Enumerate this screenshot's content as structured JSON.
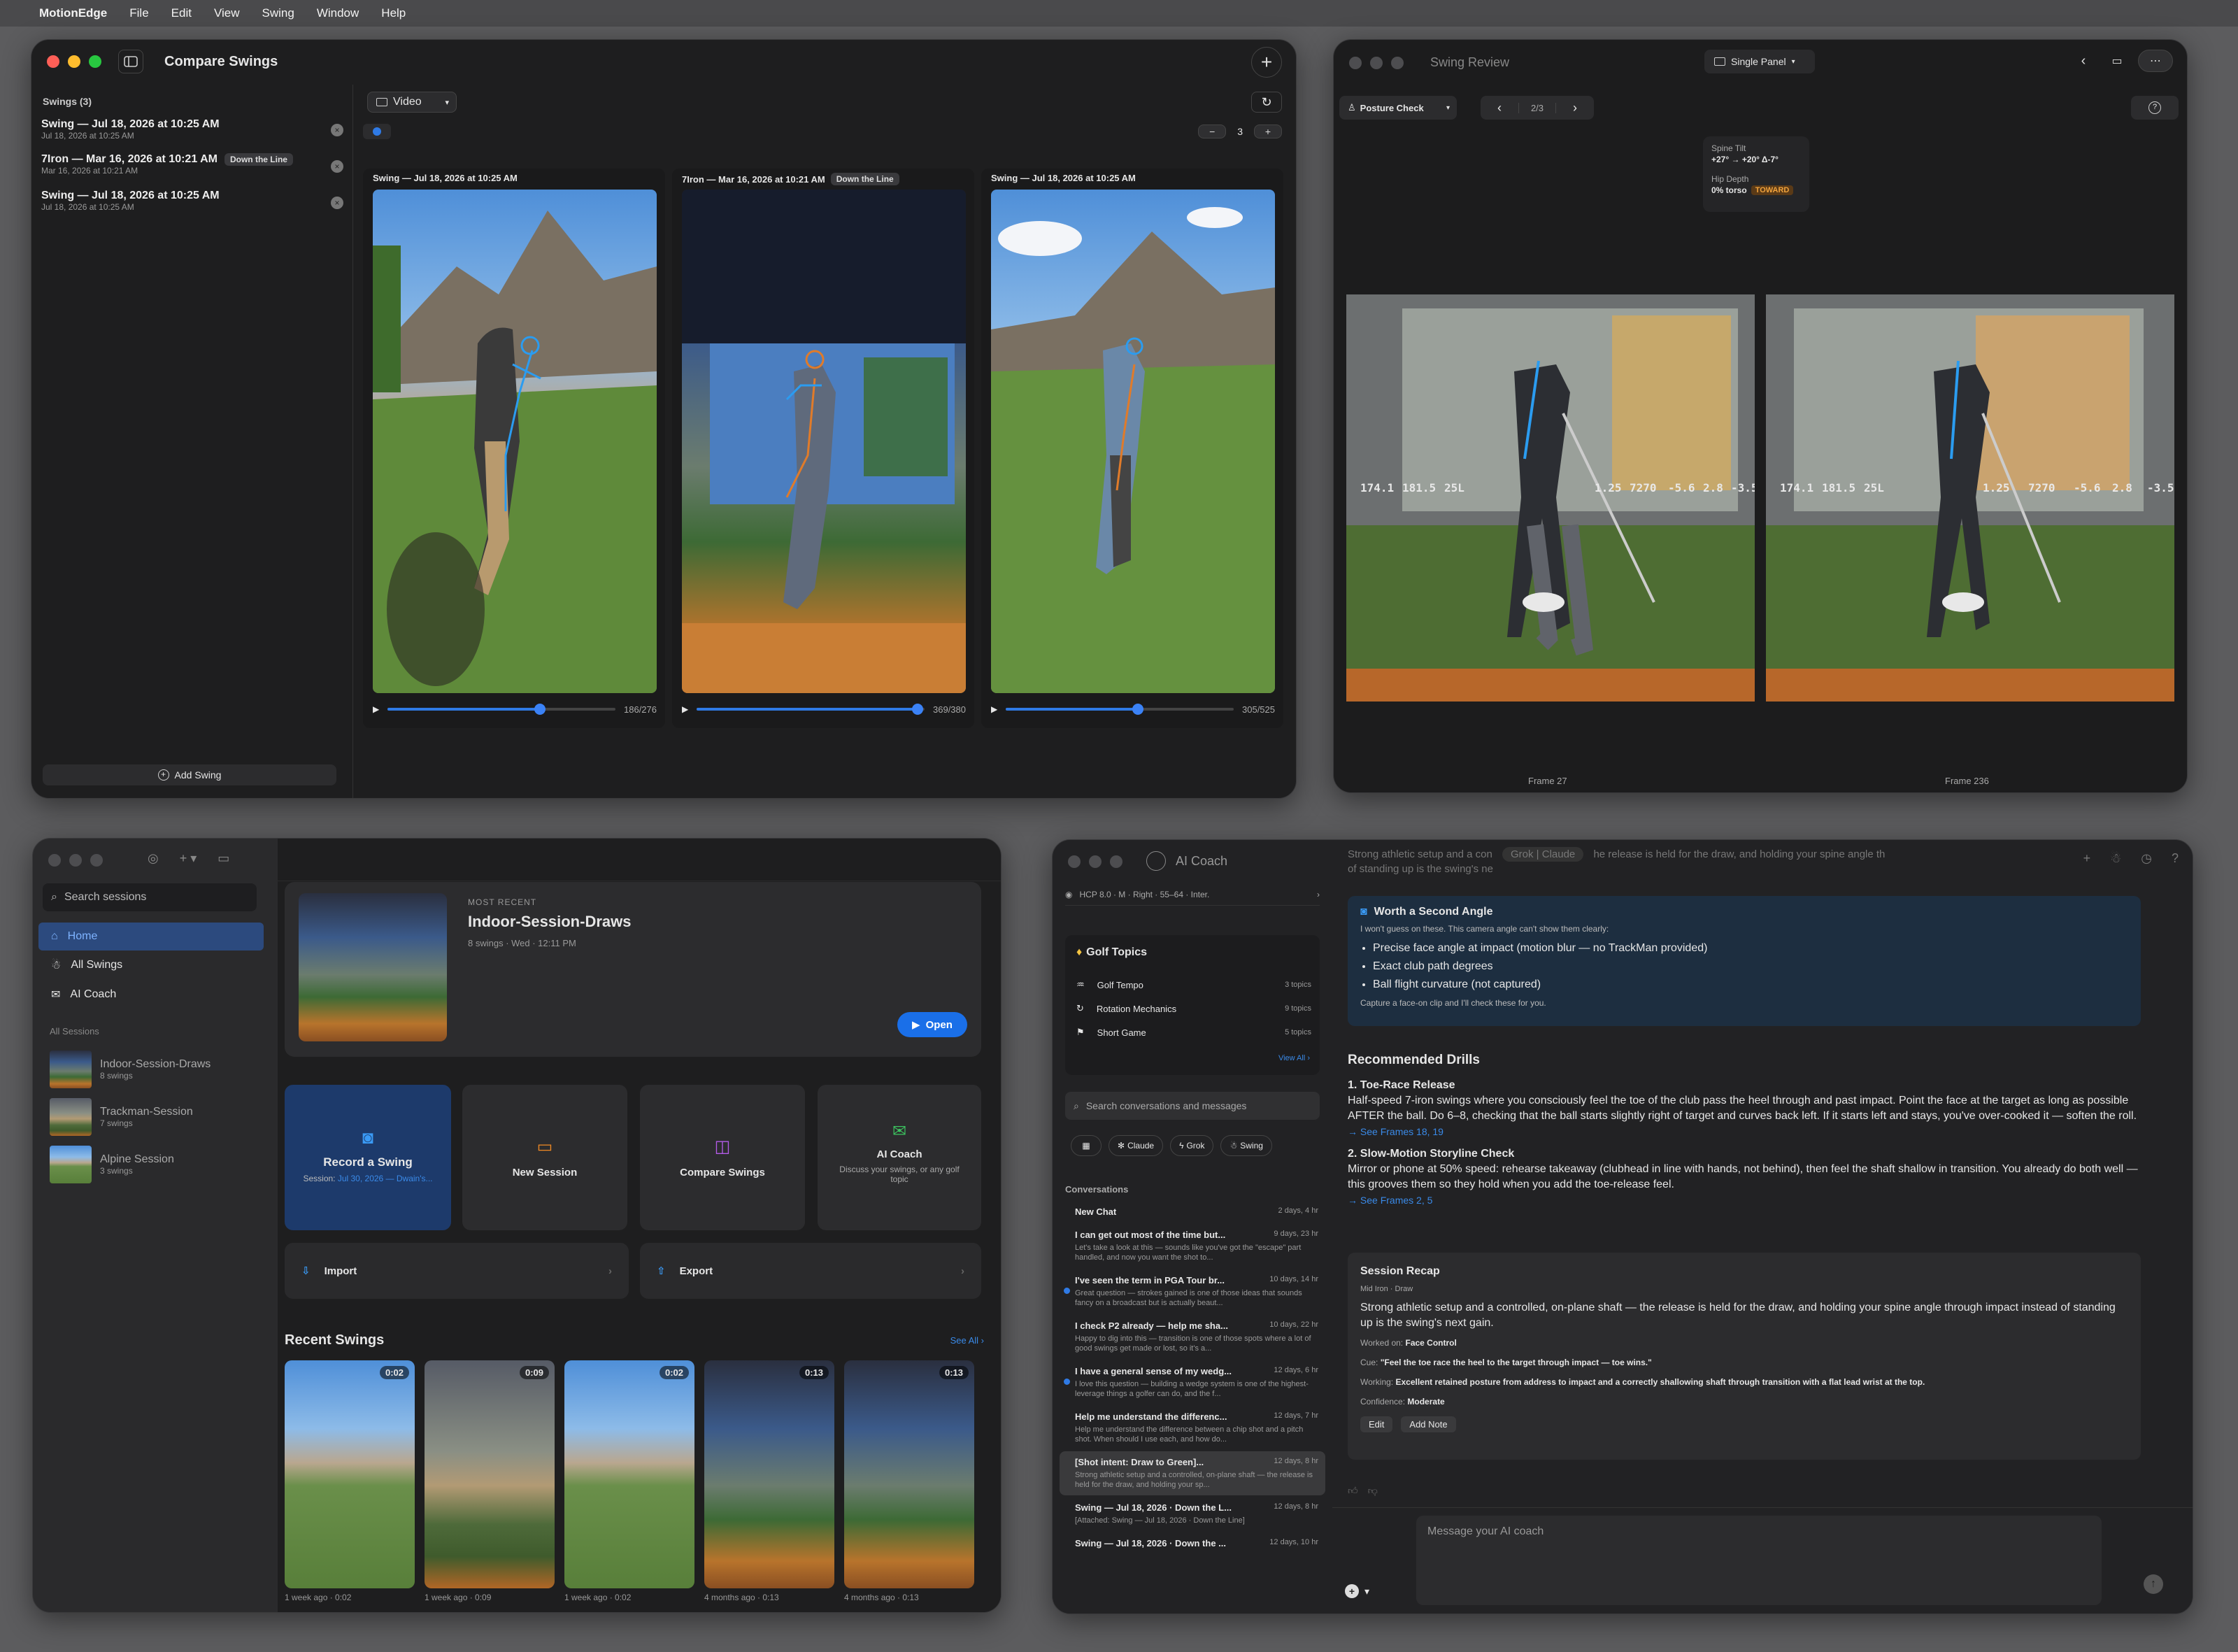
{
  "menubar": {
    "app": "MotionEdge",
    "items": [
      "File",
      "Edit",
      "View",
      "Swing",
      "Window",
      "Help"
    ]
  },
  "compare": {
    "title": "Compare Swings",
    "swings_header": "Swings (3)",
    "swings": [
      {
        "name": "Swing — Jul 18, 2026 at 10:25 AM",
        "date": "Jul 18, 2026 at 10:25 AM",
        "tag": ""
      },
      {
        "name": "7Iron — Mar 16, 2026 at 10:21 AM",
        "date": "Mar 16, 2026 at 10:21 AM",
        "tag": "Down the Line"
      },
      {
        "name": "Swing — Jul 18, 2026 at 10:25 AM",
        "date": "Jul 18, 2026 at 10:25 AM",
        "tag": ""
      }
    ],
    "add_swing": "Add Swing",
    "mode": "Video",
    "count": "3",
    "panels": [
      {
        "title": "Swing — Jul 18, 2026 at 10:25 AM",
        "tag": "",
        "frames": "186/276",
        "progress": 0.67
      },
      {
        "title": "7Iron — Mar 16, 2026 at 10:21 AM",
        "tag": "Down the Line",
        "frames": "369/380",
        "progress": 0.97
      },
      {
        "title": "Swing — Jul 18, 2026 at 10:25 AM",
        "tag": "",
        "frames": "305/525",
        "progress": 0.58
      }
    ]
  },
  "review": {
    "title": "Swing Review",
    "layout": "Single Panel",
    "check": "Posture Check",
    "page": "2/3",
    "metrics": {
      "spine_label": "Spine Tilt",
      "spine_value": "+27° → +20° Δ-7°",
      "hip_label": "Hip Depth",
      "hip_value": "0% torso",
      "hip_tag": "TOWARD"
    },
    "frames": [
      "Frame 27",
      "Frame 236"
    ],
    "overlay_numbers": [
      "174.1",
      "181.5",
      "25L",
      "1.25",
      "7270",
      "-5.6",
      "2.8",
      "-3.5"
    ]
  },
  "home": {
    "search_placeholder": "Search sessions",
    "nav": [
      {
        "label": "Home",
        "icon": "house-icon"
      },
      {
        "label": "All Swings",
        "icon": "golfer-icon"
      },
      {
        "label": "AI Coach",
        "icon": "chat-icon"
      }
    ],
    "sessions_header": "All Sessions",
    "sessions": [
      {
        "name": "Indoor-Session-Draws",
        "count": "8 swings"
      },
      {
        "name": "Trackman-Session",
        "count": "7 swings"
      },
      {
        "name": "Alpine Session",
        "count": "3 swings"
      }
    ],
    "recent_label": "MOST RECENT",
    "recent_title": "Indoor-Session-Draws",
    "recent_meta": "8 swings · Wed · 12:11 PM",
    "open": "Open",
    "actions": [
      {
        "title": "Record a Swing",
        "sub_prefix": "Session: ",
        "sub_link": "Jul 30, 2026 — Dwain's...",
        "icon": "camera-icon"
      },
      {
        "title": "New Session",
        "sub_prefix": "",
        "sub_link": "",
        "icon": "folder-icon"
      },
      {
        "title": "Compare Swings",
        "sub_prefix": "",
        "sub_link": "",
        "icon": "compare-icon"
      },
      {
        "title": "AI Coach",
        "sub_prefix": "Discuss your swings, or any golf topic",
        "sub_link": "",
        "icon": "chat-icon"
      }
    ],
    "import": "Import",
    "export": "Export",
    "recent_swings": "Recent Swings",
    "see_all": "See All",
    "thumbs": [
      {
        "dur": "0:02",
        "meta": "1 week ago · 0:02"
      },
      {
        "dur": "0:09",
        "meta": "1 week ago · 0:09"
      },
      {
        "dur": "0:02",
        "meta": "1 week ago · 0:02"
      },
      {
        "dur": "0:13",
        "meta": "4 months ago · 0:13"
      },
      {
        "dur": "0:13",
        "meta": "4 months ago · 0:13"
      }
    ]
  },
  "coach": {
    "title": "AI Coach",
    "profile": "HCP 8.0 · M · Right · 55–64 · Inter.",
    "topics_title": "Golf Topics",
    "topics": [
      {
        "name": "Golf Tempo",
        "count": "3 topics"
      },
      {
        "name": "Rotation Mechanics",
        "count": "9 topics"
      },
      {
        "name": "Short Game",
        "count": "5 topics"
      }
    ],
    "view_all": "View All",
    "search_placeholder": "Search conversations and messages",
    "filters": [
      "Claude",
      "Grok",
      "Swing"
    ],
    "conv_header": "Conversations",
    "conversations": [
      {
        "title": "New Chat",
        "time": "2 days, 4 hr",
        "preview": "",
        "dot": false,
        "selected": false
      },
      {
        "title": "I can get out most of the time but...",
        "time": "9 days, 23 hr",
        "preview": "Let's take a look at this — sounds like you've got the \"escape\" part handled, and now you want the shot to...",
        "dot": false,
        "selected": false
      },
      {
        "title": "I've seen the term in PGA Tour br...",
        "time": "10 days, 14 hr",
        "preview": "Great question — strokes gained is one of those ideas that sounds fancy on a broadcast but is actually beaut...",
        "dot": true,
        "selected": false
      },
      {
        "title": "I check P2 already — help me sha...",
        "time": "10 days, 22 hr",
        "preview": "Happy to dig into this — transition is one of those spots where a lot of good swings get made or lost, so it's a...",
        "dot": false,
        "selected": false
      },
      {
        "title": "I have a general sense of my wedg...",
        "time": "12 days, 6 hr",
        "preview": "I love this question — building a wedge system is one of the highest-leverage things a golfer can do, and the f...",
        "dot": true,
        "selected": false
      },
      {
        "title": "Help me understand the differenc...",
        "time": "12 days, 7 hr",
        "preview": "Help me understand the difference between a chip shot and a pitch shot. When should I use each, and how do...",
        "dot": false,
        "selected": false
      },
      {
        "title": "[Shot intent: Draw to Green]...",
        "time": "12 days, 8 hr",
        "preview": "Strong athletic setup and a controlled, on-plane shaft — the release is held for the draw, and holding your sp...",
        "dot": false,
        "selected": true
      },
      {
        "title": "Swing — Jul 18, 2026 · Down the L...",
        "time": "12 days, 8 hr",
        "preview": "[Attached: Swing — Jul 18, 2026 · Down the Line]",
        "dot": false,
        "selected": false
      },
      {
        "title": "Swing — Jul 18, 2026 · Down the ...",
        "time": "12 days, 10 hr",
        "preview": "",
        "dot": false,
        "selected": false
      }
    ],
    "top_text": "Strong athletic setup and a con",
    "top_text_2": "he release is held for the draw, and holding your spine angle th",
    "top_text_3": "of standing up is the swing's ne",
    "models": [
      "Grok",
      "Claude"
    ],
    "second_angle": {
      "title": "Worth a Second Angle",
      "intro": "I won't guess on these. This camera angle can't show them clearly:",
      "items": [
        "Precise face angle at impact (motion blur — no TrackMan provided)",
        "Exact club path degrees",
        "Ball flight curvature (not captured)"
      ],
      "footer": "Capture a face-on clip and I'll check these for you."
    },
    "drills_title": "Recommended Drills",
    "drills": [
      {
        "title": "1. Toe-Race Release",
        "body": "Half-speed 7-iron swings where you consciously feel the toe of the club pass the heel through and past impact. Point the face at the target as long as possible AFTER the ball. Do 6–8, checking that the ball starts slightly right of target and curves back left. If it starts left and stays, you've over-cooked it — soften the roll.",
        "link": "→ See Frames 18, 19"
      },
      {
        "title": "2. Slow-Motion Storyline Check",
        "body": "Mirror or phone at 50% speed: rehearse takeaway (clubhead in line with hands, not behind), then feel the shaft shallow in transition. You already do both well — this grooves them so they hold when you add the toe-release feel.",
        "link": "→ See Frames 2, 5"
      }
    ],
    "recap": {
      "title": "Session Recap",
      "sub": "Mid Iron · Draw",
      "body": "Strong athletic setup and a controlled, on-plane shaft — the release is held for the draw, and holding your spine angle through impact instead of standing up is the swing's next gain.",
      "worked_label": "Worked on:",
      "worked": "Face Control",
      "cue_label": "Cue:",
      "cue": "\"Feel the toe race the heel to the target through impact — toe wins.\"",
      "working_label": "Working:",
      "working": "Excellent retained posture from address to impact and a correctly shallowing shaft through transition with a flat lead wrist at the top.",
      "conf_label": "Confidence:",
      "conf": "Moderate",
      "edit": "Edit",
      "add_note": "Add Note"
    },
    "input_placeholder": "Message your AI coach"
  }
}
